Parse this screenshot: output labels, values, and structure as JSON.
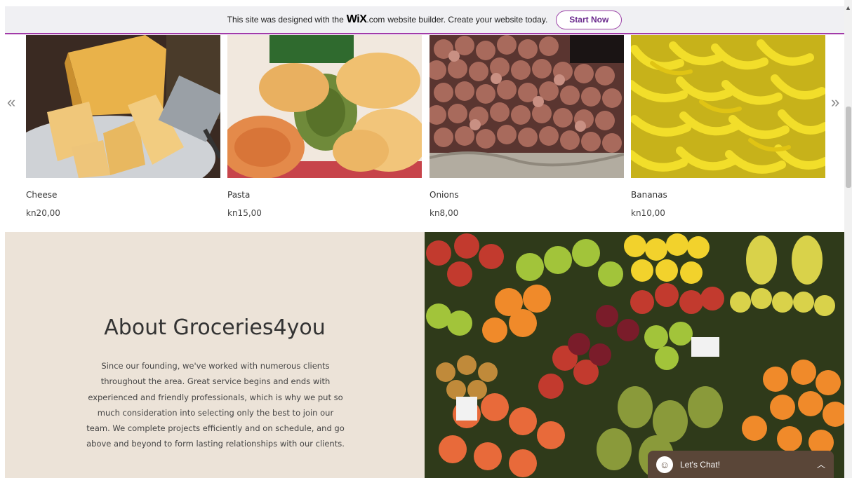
{
  "banner": {
    "text_before": "This site was designed with the",
    "logo": "WiX",
    "logo_suffix": ".com",
    "text_after": "website builder. Create your website today.",
    "cta": "Start Now"
  },
  "carousel": {
    "prev_icon": "«",
    "next_icon": "»",
    "products": [
      {
        "name": "Cheese",
        "price": "kn20,00"
      },
      {
        "name": "Pasta",
        "price": "kn15,00"
      },
      {
        "name": "Onions",
        "price": "kn8,00"
      },
      {
        "name": "Bananas",
        "price": "kn10,00"
      }
    ]
  },
  "about": {
    "title": "About Groceries4you",
    "body": "Since our founding, we've worked with numerous clients throughout the area. Great service begins and ends with experienced and friendly professionals, which is why we put so much consideration into selecting only the best to join our team. We complete projects efficiently and on schedule, and go above and beyond to form lasting relationships with our clients."
  },
  "chat": {
    "label": "Let's Chat!",
    "icon": "smiley-icon"
  },
  "colors": {
    "banner_accent": "#a23aa8",
    "about_bg": "#ece3d8",
    "chat_bg": "#5a4638"
  }
}
